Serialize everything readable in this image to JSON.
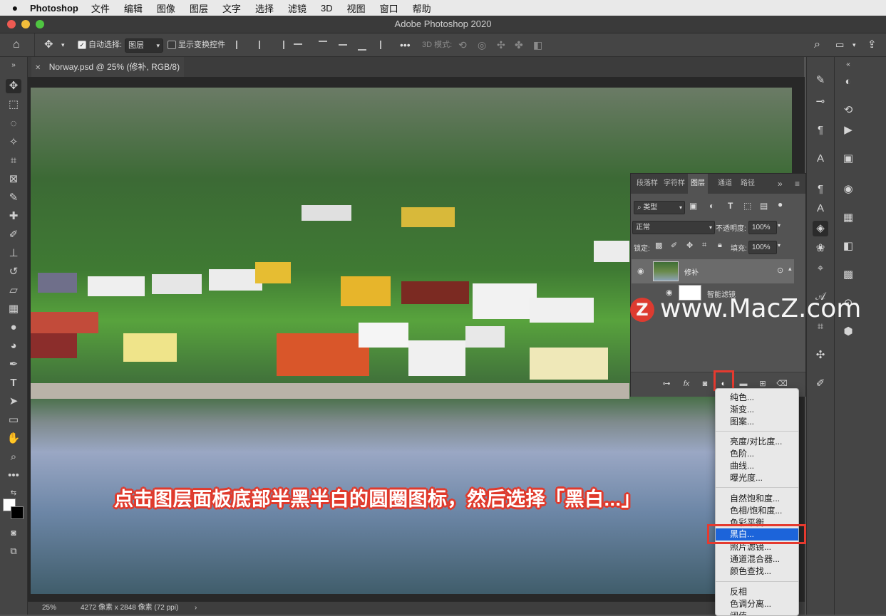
{
  "menubar": {
    "apple_icon": "apple-logo-icon",
    "app_name": "Photoshop",
    "items": [
      "文件",
      "编辑",
      "图像",
      "图层",
      "文字",
      "选择",
      "滤镜",
      "3D",
      "视图",
      "窗口",
      "帮助"
    ]
  },
  "window": {
    "title": "Adobe Photoshop 2020"
  },
  "options_bar": {
    "auto_select_label": "自动选择:",
    "auto_select_value": "图层",
    "show_transform_label": "显示变换控件",
    "mode_3d_label": "3D 模式:"
  },
  "document_tab": {
    "title": "Norway.psd @ 25% (修补, RGB/8) *"
  },
  "status": {
    "zoom": "25%",
    "dimensions": "4272 像素 x 2848 像素 (72 ppi)"
  },
  "layers_panel": {
    "tabs": [
      "段落样",
      "字符样",
      "图层",
      "通道",
      "路径"
    ],
    "active_tab": "图层",
    "filter_kind": "类型",
    "blend_mode": "正常",
    "opacity_label": "不透明度:",
    "opacity_value": "100%",
    "lock_label": "锁定:",
    "fill_label": "填充:",
    "fill_value": "100%",
    "layer_name": "修补",
    "smart_filter_label": "智能滤镜"
  },
  "adjustment_menu": {
    "group1": [
      "纯色...",
      "渐变...",
      "图案..."
    ],
    "group2": [
      "亮度/对比度...",
      "色阶...",
      "曲线...",
      "曝光度..."
    ],
    "group3": [
      "自然饱和度...",
      "色相/饱和度...",
      "色彩平衡..."
    ],
    "highlighted": "黑白...",
    "group4": [
      "照片滤镜...",
      "通道混合器...",
      "颜色查找..."
    ],
    "group5": [
      "反相",
      "色调分离...",
      "阈值..."
    ]
  },
  "caption": "点击图层面板底部半黑半白的圆圈图标，然后选择「黑白...」",
  "watermark": {
    "logo_letter": "Z",
    "text": "www.MacZ.com"
  },
  "colors": {
    "highlight": "#1c64da",
    "callout_red": "#e53a2f",
    "panel_bg": "#535353"
  }
}
